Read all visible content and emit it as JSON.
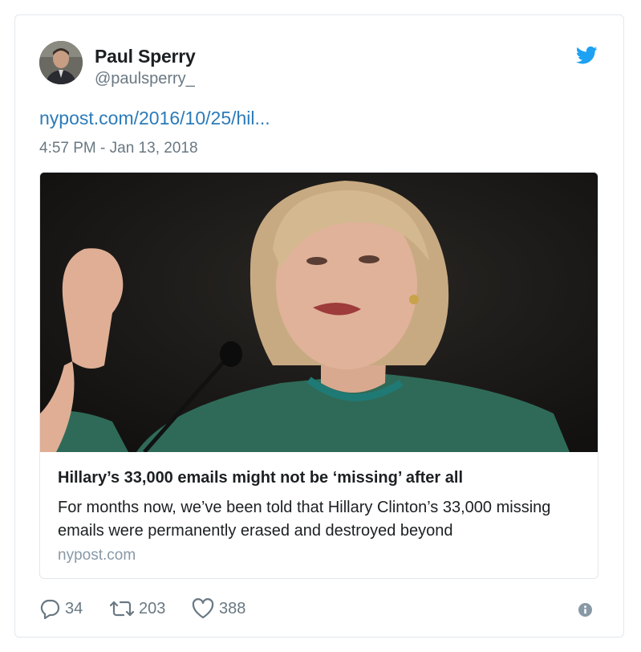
{
  "author": {
    "name": "Paul Sperry",
    "handle": "@paulsperry_",
    "avatar_icon": "user-avatar"
  },
  "tweet": {
    "link_text": "nypost.com/2016/10/25/hil...",
    "timestamp": "4:57 PM - Jan 13, 2018"
  },
  "card": {
    "image_icon": "article-photo",
    "title": "Hillary’s 33,000 emails might not be ‘missing’ after all",
    "description": "For months now, we’ve been told that Hillary Clinton’s 33,000 missing emails were permanently erased and destroyed beyond",
    "domain": "nypost.com"
  },
  "actions": {
    "replies": "34",
    "retweets": "203",
    "likes": "388",
    "reply_icon": "reply-icon",
    "retweet_icon": "retweet-icon",
    "like_icon": "heart-icon",
    "info_icon": "info-icon"
  },
  "colors": {
    "link": "#2b7bb9",
    "twitter_blue": "#1da1f2",
    "muted": "#697882",
    "border": "#e1e8ed"
  }
}
